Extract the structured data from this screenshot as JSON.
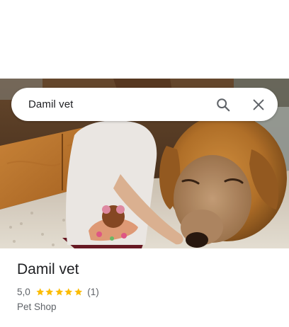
{
  "search": {
    "query": "Damil vet",
    "search_icon": "search-icon",
    "close_icon": "close-icon"
  },
  "photo": {
    "subject": "child-and-golden-dog-photo"
  },
  "place": {
    "name": "Damil vet",
    "rating_value": "5,0",
    "stars": 5,
    "review_count": "(1)",
    "category": "Pet Shop"
  },
  "colors": {
    "star": "#fbbc04",
    "text_primary": "#202124",
    "text_secondary": "#5f6368"
  }
}
